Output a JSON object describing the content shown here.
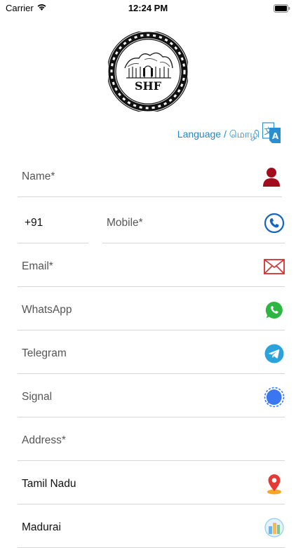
{
  "status_bar": {
    "carrier": "Carrier",
    "time": "12:24 PM"
  },
  "logo": {
    "text": "SHF"
  },
  "language": {
    "label": "Language / மொழி",
    "icon": "translate-icon"
  },
  "form": {
    "name": {
      "placeholder": "Name*",
      "icon": "person-icon"
    },
    "country_code": {
      "value": "+91"
    },
    "mobile": {
      "placeholder": "Mobile*",
      "icon": "phone-icon"
    },
    "email": {
      "placeholder": "Email*",
      "icon": "mail-icon"
    },
    "whatsapp": {
      "placeholder": "WhatsApp",
      "icon": "whatsapp-icon"
    },
    "telegram": {
      "placeholder": "Telegram",
      "icon": "telegram-icon"
    },
    "signal": {
      "placeholder": "Signal",
      "icon": "signal-icon"
    },
    "address": {
      "placeholder": "Address*"
    },
    "state": {
      "value": "Tamil Nadu",
      "icon": "location-pin-icon"
    },
    "city": {
      "value": "Madurai",
      "icon": "city-icon"
    }
  },
  "colors": {
    "accent": "#1e88c9",
    "person": "#a10d1d",
    "phone": "#1565c0",
    "mail": "#d32f2f",
    "whatsapp": "#2db742",
    "telegram": "#2aa3dd",
    "signal": "#3a76f0",
    "pin": "#e53935"
  }
}
